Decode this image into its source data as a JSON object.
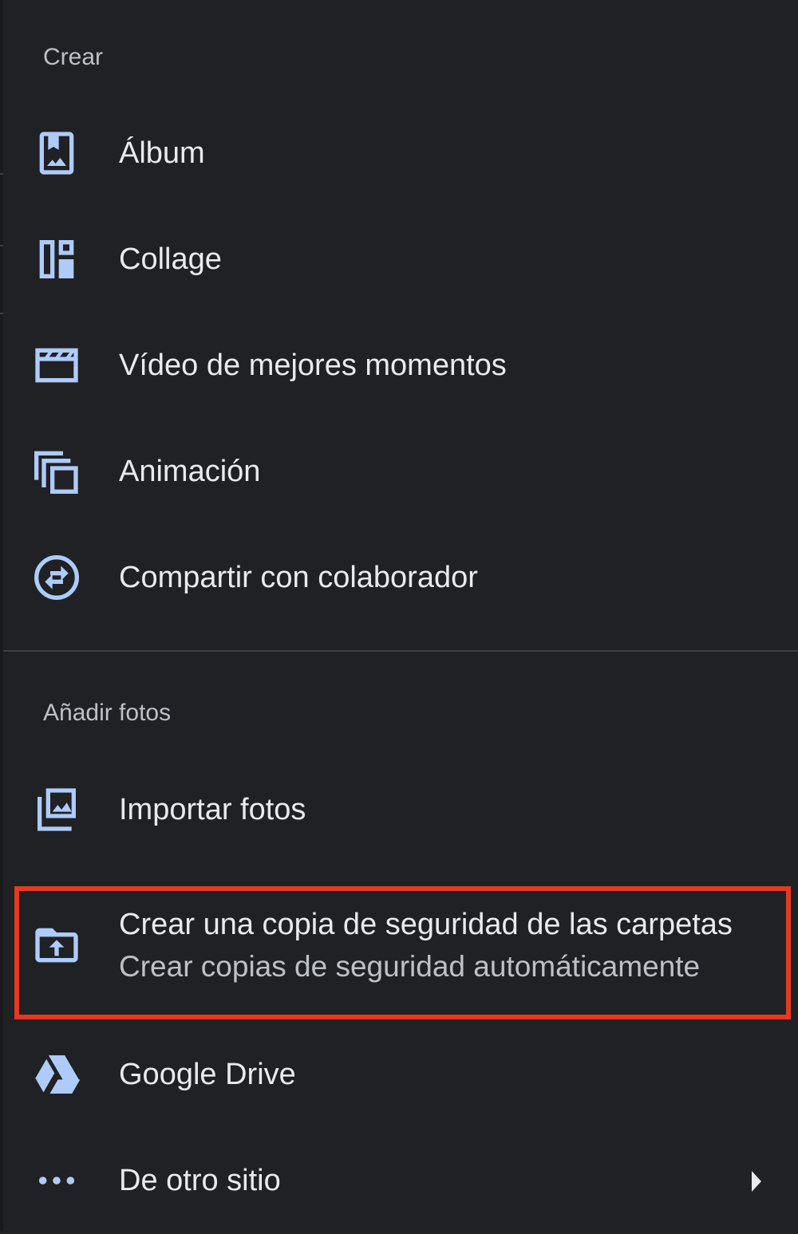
{
  "sections": {
    "create": {
      "header": "Crear",
      "items": [
        {
          "label": "Álbum",
          "icon": "album-icon"
        },
        {
          "label": "Collage",
          "icon": "collage-icon"
        },
        {
          "label": "Vídeo de mejores momentos",
          "icon": "movie-icon"
        },
        {
          "label": "Animación",
          "icon": "animation-icon"
        },
        {
          "label": "Compartir con colaborador",
          "icon": "partner-sharing-icon"
        }
      ]
    },
    "add": {
      "header": "Añadir fotos",
      "items": [
        {
          "label": "Importar fotos",
          "icon": "import-photos-icon"
        },
        {
          "label": "Crear una copia de seguridad de las carpetas",
          "secondary": "Crear copias de seguridad automáticamente",
          "icon": "folder-upload-icon"
        },
        {
          "label": "Google Drive",
          "icon": "google-drive-icon"
        },
        {
          "label": "De otro sitio",
          "icon": "more-horiz-icon",
          "has_submenu": true
        }
      ]
    }
  },
  "colors": {
    "background": "#202124",
    "primary_text": "#e8eaed",
    "secondary_text": "#bdc1c6",
    "icon": "#aecbfa",
    "highlight_border": "#e8381f"
  }
}
